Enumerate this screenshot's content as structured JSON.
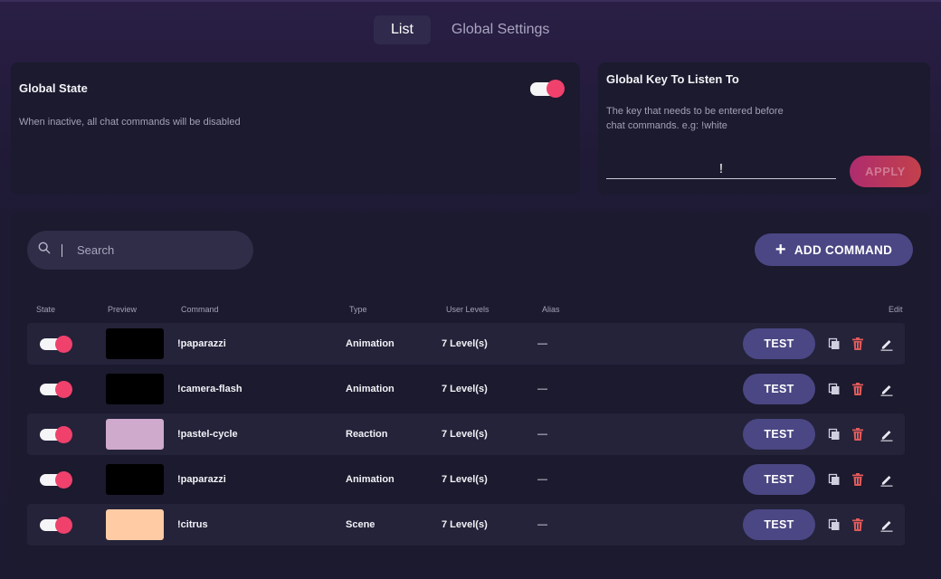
{
  "tabs": [
    {
      "label": "List",
      "active": true
    },
    {
      "label": "Global Settings",
      "active": false
    }
  ],
  "global_state": {
    "title": "Global State",
    "description": "When inactive, all chat commands will be disabled",
    "enabled": true
  },
  "global_key": {
    "title": "Global Key To Listen To",
    "description_line1": "The key that needs to be entered before",
    "description_line2": "chat commands. e.g: !white",
    "value": "!",
    "apply_label": "APPLY"
  },
  "toolbar": {
    "search_placeholder": "Search",
    "add_label": "ADD COMMAND"
  },
  "table": {
    "headers": {
      "state": "State",
      "preview": "Preview",
      "command": "Command",
      "type": "Type",
      "user_levels": "User Levels",
      "alias": "Alias",
      "edit": "Edit"
    },
    "test_label": "TEST",
    "rows": [
      {
        "enabled": true,
        "preview_color": "#000000",
        "command": "!paparazzi",
        "type": "Animation",
        "user_levels": "7 Level(s)",
        "alias": "—"
      },
      {
        "enabled": true,
        "preview_color": "#000000",
        "command": "!camera-flash",
        "type": "Animation",
        "user_levels": "7 Level(s)",
        "alias": "—"
      },
      {
        "enabled": true,
        "preview_color": "#cfaacd",
        "command": "!pastel-cycle",
        "type": "Reaction",
        "user_levels": "7 Level(s)",
        "alias": "—"
      },
      {
        "enabled": true,
        "preview_color": "#000000",
        "command": "!paparazzi",
        "type": "Animation",
        "user_levels": "7 Level(s)",
        "alias": "—"
      },
      {
        "enabled": true,
        "preview_color": "#ffcba4",
        "command": "!citrus",
        "type": "Scene",
        "user_levels": "7 Level(s)",
        "alias": "—"
      }
    ]
  },
  "colors": {
    "accent": "#f0416c",
    "button": "#4b4784",
    "delete_icon": "#e05a5a"
  },
  "icons": {
    "copy": "copy-icon",
    "delete": "trash-icon",
    "edit": "pencil-icon",
    "search": "search-icon",
    "add": "plus-icon"
  }
}
